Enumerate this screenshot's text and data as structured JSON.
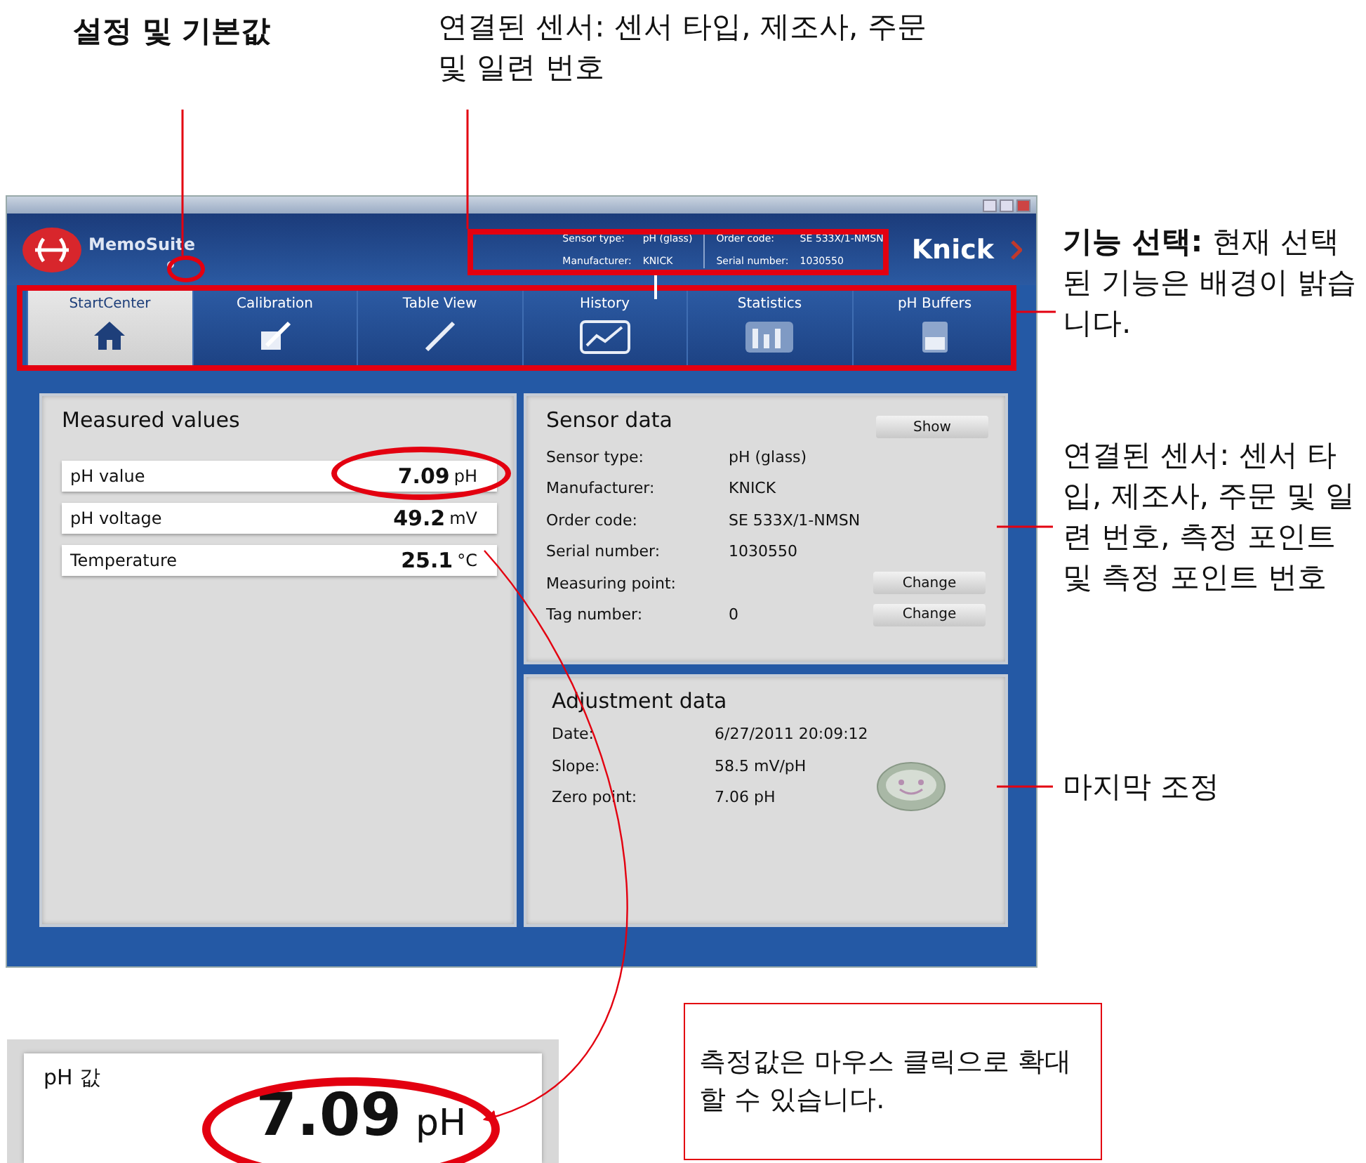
{
  "callouts": {
    "settings": "설정 및 기본값",
    "sensor_header": "연결된 센서: 센서 타입, 제조사, 주문 및 일련 번호",
    "function_select": "**기능 선택:** 현재 선택된 기능은 배경이 밝습니다.",
    "sensor_data": "연결된 센서: 센서 타입, 제조사, 주문 및 일련 번호, 측정 포인트 및 측정 포인트 번호",
    "adjustment": "마지막 조정",
    "zoom_note": "측정값은 마우스 클릭으로 확대할 수 있습니다."
  },
  "window": {
    "logo": "MemoSuite",
    "brand": "Knick",
    "sensor_info": [
      {
        "label": "Sensor type:",
        "value": "pH (glass)"
      },
      {
        "label": "Manufacturer:",
        "value": "KNICK"
      },
      {
        "label": "Order code:",
        "value": "SE 533X/1-NMSN"
      },
      {
        "label": "Serial number:",
        "value": "1030550"
      }
    ]
  },
  "tabs": [
    {
      "label": "StartCenter",
      "selected": true
    },
    {
      "label": "Calibration",
      "selected": false
    },
    {
      "label": "Table View",
      "selected": false
    },
    {
      "label": "History",
      "selected": false
    },
    {
      "label": "Statistics",
      "selected": false
    },
    {
      "label": "pH Buffers",
      "selected": false
    }
  ],
  "measured_values": {
    "title": "Measured values",
    "rows": [
      {
        "label": "pH value",
        "value": "7.09",
        "unit": "pH",
        "circled": true
      },
      {
        "label": "pH voltage",
        "value": "49.2",
        "unit": "mV",
        "circled": false
      },
      {
        "label": "Temperature",
        "value": "25.1",
        "unit": "°C",
        "circled": false
      }
    ]
  },
  "sensor_data": {
    "title": "Sensor data",
    "button": "Show",
    "rows": [
      {
        "label": "Sensor type:",
        "value": "pH (glass)"
      },
      {
        "label": "Manufacturer:",
        "value": "KNICK"
      },
      {
        "label": "Order code:",
        "value": "SE 533X/1-NMSN"
      },
      {
        "label": "Serial number:",
        "value": "1030550"
      },
      {
        "label": "Measuring point:",
        "button": "Change"
      },
      {
        "label": "Tag number:",
        "value": "0",
        "button": "Change"
      }
    ]
  },
  "adjustment_data": {
    "title": "Adjustment data",
    "rows": [
      {
        "label": "Date:",
        "value": "6/27/2011  20:09:12"
      },
      {
        "label": "Slope:",
        "value": "58.5 mV/pH"
      },
      {
        "label": "Zero point:",
        "value": "7.06 pH"
      }
    ]
  },
  "zoom_view": {
    "label": "pH 값",
    "value": "7.09",
    "unit": "pH"
  }
}
